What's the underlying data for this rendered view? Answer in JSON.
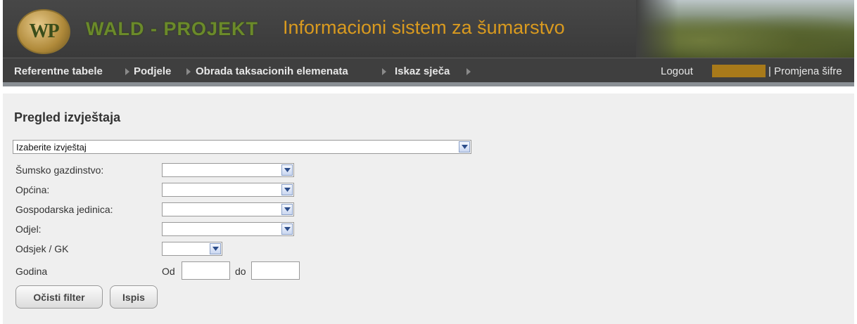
{
  "header": {
    "logo_text": "WP",
    "brand": "WALD - PROJEKT",
    "system_title": "Informacioni sistem za šumarstvo"
  },
  "nav": {
    "items": [
      {
        "label": "Referentne tabele"
      },
      {
        "label": "Podjele"
      },
      {
        "label": "Obrada taksacionih elemenata"
      },
      {
        "label": "Iskaz sječa"
      }
    ],
    "logout": "Logout",
    "password_change": "| Promjena šifre"
  },
  "main": {
    "title": "Pregled izvještaja",
    "report_select": "Izaberite izvještaj",
    "fields": {
      "forest_management": "Šumsko gazdinstvo:",
      "municipality": "Općina:",
      "economic_unit": "Gospodarska jedinica:",
      "department": "Odjel:",
      "section": "Odsjek / GK",
      "year": "Godina",
      "from": "Od",
      "to": "do"
    },
    "buttons": {
      "clear": "Očisti filter",
      "print": "Ispis"
    }
  },
  "colors": {
    "header_bg": "#3f3f3f",
    "brand": "#6b8a2a",
    "title_orange": "#d99a1f",
    "user_box": "#a87a1a",
    "content_bg": "#efefef"
  }
}
